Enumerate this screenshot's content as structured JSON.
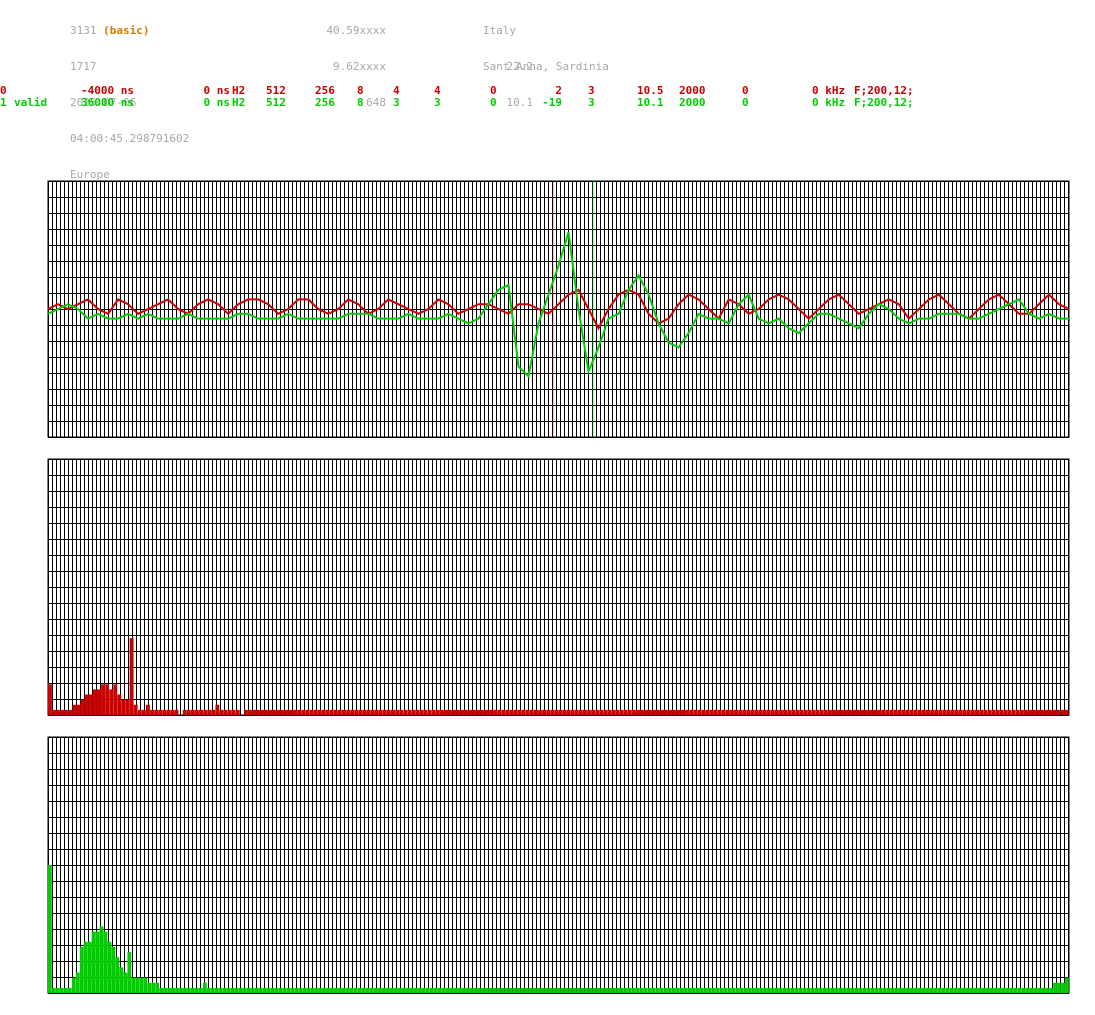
{
  "header": {
    "col1": [
      "3131",
      "1717",
      "2025-07-06",
      "04:00:45.298791602",
      "Europe"
    ],
    "basic_tag": "(basic)",
    "col2": [
      "40.59xxxx",
      "9.62xxxx",
      "648"
    ],
    "col3": [
      "Italy",
      "Sant Anna, Sardinia"
    ],
    "col4": [
      "22.2",
      "10.1"
    ]
  },
  "colors": {
    "red": "#cc0000",
    "green": "#00cc00",
    "grid": "#000000",
    "header_gray": "#a8a8a8",
    "basic_orange": "#d67a00"
  },
  "channels": [
    {
      "id": "0",
      "status": "",
      "offset": "-4000 ns",
      "delay": "0 ns",
      "type": "H2",
      "n1": "512",
      "n2": "256",
      "n3": "8",
      "n4": "4",
      "n5": "4",
      "n6": "0",
      "n7": "2",
      "n8": "3",
      "n9": "10.5",
      "n10": "2000",
      "n11": "0",
      "freq": "0 kHz",
      "filter": "F;200,12;"
    },
    {
      "id": "1",
      "status": "valid",
      "offset": "36000 ns",
      "delay": "0 ns",
      "type": "H2",
      "n1": "512",
      "n2": "256",
      "n3": "8",
      "n4": "3",
      "n5": "3",
      "n6": "0",
      "n7": "-19",
      "n8": "3",
      "n9": "10.1",
      "n10": "2000",
      "n11": "0",
      "freq": "0 kHz",
      "filter": "F;200,12;"
    }
  ],
  "chart_data": [
    {
      "type": "line",
      "title": "",
      "x": [
        0,
        10,
        20,
        30,
        40,
        50,
        60,
        70,
        80,
        90,
        100,
        110,
        120,
        130,
        140,
        150,
        160,
        170,
        180,
        190,
        200,
        210,
        220,
        230,
        240,
        250,
        260,
        270,
        280,
        290,
        300,
        310,
        320,
        330,
        340,
        350,
        360,
        370,
        380,
        390,
        400,
        410,
        420,
        430,
        440,
        450,
        460,
        470,
        480,
        490,
        500,
        510,
        520,
        530,
        540,
        550,
        560,
        570,
        580,
        590,
        600,
        610,
        620,
        630,
        640,
        650,
        660,
        670,
        680,
        690,
        700,
        710,
        720,
        730,
        740,
        750,
        760,
        770,
        780,
        790,
        800,
        810,
        820,
        830,
        840,
        850,
        860,
        870,
        880,
        890,
        900,
        910,
        920,
        930,
        940,
        950,
        960,
        970,
        980,
        990,
        1000,
        1010,
        1020
      ],
      "series": [
        {
          "color": "#cc0000",
          "values": [
            0.0,
            0.1,
            0.0,
            0.1,
            0.2,
            0.0,
            -0.1,
            0.2,
            0.1,
            -0.1,
            0.0,
            0.1,
            0.2,
            0.0,
            -0.1,
            0.1,
            0.2,
            0.1,
            -0.1,
            0.1,
            0.2,
            0.2,
            0.1,
            -0.1,
            0.0,
            0.2,
            0.2,
            0.0,
            -0.1,
            0.0,
            0.2,
            0.1,
            -0.1,
            0.0,
            0.2,
            0.1,
            0.0,
            -0.1,
            0.0,
            0.2,
            0.1,
            -0.1,
            0.0,
            0.1,
            0.1,
            0.0,
            -0.1,
            0.1,
            0.1,
            0.0,
            -0.1,
            0.1,
            0.3,
            0.4,
            0.0,
            -0.4,
            0.0,
            0.3,
            0.4,
            0.3,
            -0.1,
            -0.3,
            -0.2,
            0.1,
            0.3,
            0.2,
            0.0,
            -0.2,
            0.2,
            0.1,
            -0.1,
            0.0,
            0.2,
            0.3,
            0.2,
            0.0,
            -0.2,
            0.0,
            0.2,
            0.3,
            0.1,
            -0.1,
            0.0,
            0.1,
            0.2,
            0.1,
            -0.2,
            0.0,
            0.2,
            0.3,
            0.1,
            -0.1,
            -0.2,
            0.0,
            0.2,
            0.3,
            0.1,
            -0.1,
            -0.1,
            0.1,
            0.3,
            0.1,
            0.0
          ]
        },
        {
          "color": "#00cc00",
          "values": [
            -0.1,
            0.0,
            0.1,
            0.0,
            -0.2,
            -0.1,
            -0.2,
            -0.2,
            -0.1,
            -0.2,
            -0.1,
            -0.2,
            -0.2,
            -0.2,
            -0.1,
            -0.2,
            -0.2,
            -0.2,
            -0.2,
            -0.1,
            -0.1,
            -0.2,
            -0.2,
            -0.2,
            -0.1,
            -0.2,
            -0.2,
            -0.2,
            -0.2,
            -0.2,
            -0.1,
            -0.1,
            -0.1,
            -0.2,
            -0.2,
            -0.2,
            -0.1,
            -0.2,
            -0.2,
            -0.2,
            -0.1,
            -0.2,
            -0.3,
            -0.2,
            0.1,
            0.4,
            0.5,
            -1.2,
            -1.4,
            -0.3,
            0.3,
            0.9,
            1.6,
            0.0,
            -1.3,
            -0.8,
            -0.2,
            -0.1,
            0.4,
            0.7,
            0.3,
            -0.3,
            -0.7,
            -0.8,
            -0.5,
            -0.1,
            -0.2,
            -0.2,
            -0.3,
            0.1,
            0.3,
            -0.2,
            -0.3,
            -0.2,
            -0.4,
            -0.5,
            -0.3,
            -0.1,
            -0.1,
            -0.2,
            -0.3,
            -0.4,
            -0.1,
            0.1,
            0.0,
            -0.2,
            -0.3,
            -0.2,
            -0.2,
            -0.1,
            -0.1,
            -0.1,
            -0.2,
            -0.2,
            -0.1,
            0.0,
            0.1,
            0.2,
            -0.1,
            -0.2,
            -0.1,
            -0.2,
            -0.2
          ]
        }
      ],
      "xlim": [
        0,
        1020
      ],
      "ylim": [
        -2,
        2
      ],
      "grid": true
    },
    {
      "type": "bar",
      "title": "",
      "values": [
        6,
        1,
        1,
        1,
        1,
        1,
        2,
        2,
        3,
        4,
        4,
        5,
        5,
        6,
        6,
        5,
        6,
        4,
        3,
        3,
        15,
        2,
        1,
        1,
        2,
        1,
        1,
        1,
        1,
        1,
        1,
        1,
        0,
        1,
        1,
        1,
        1,
        1,
        1,
        1,
        1,
        2,
        1,
        1,
        1,
        1,
        1,
        0,
        1,
        1,
        1,
        1,
        1,
        1,
        1,
        1,
        1,
        1,
        1,
        1,
        1,
        1,
        1,
        1,
        1,
        1,
        1,
        1,
        1,
        1,
        1,
        1,
        1,
        1,
        1,
        1,
        1,
        1,
        1,
        1,
        1,
        1,
        1,
        1,
        1,
        1,
        1,
        1,
        1,
        1,
        1,
        1,
        1,
        1,
        1,
        1,
        1,
        1,
        1,
        1,
        1,
        1,
        1,
        1,
        1,
        1,
        1,
        1,
        1,
        1,
        1,
        1,
        1,
        1,
        1,
        1,
        1,
        1,
        1,
        1,
        1,
        1,
        1,
        1,
        1,
        1,
        1,
        1,
        1,
        1,
        1,
        1,
        1,
        1,
        1,
        1,
        1,
        1,
        1,
        1,
        1,
        1,
        1,
        1,
        1,
        1,
        1,
        1,
        1,
        1,
        1,
        1,
        1,
        1,
        1,
        1,
        1,
        1,
        1,
        1,
        1,
        1,
        1,
        1,
        1,
        1,
        1,
        1,
        1,
        1,
        1,
        1,
        1,
        1,
        1,
        1,
        1,
        1,
        1,
        1,
        1,
        1,
        1,
        1,
        1,
        1,
        1,
        1,
        1,
        1,
        1,
        1,
        1,
        1,
        1,
        1,
        1,
        1,
        1,
        1,
        1,
        1,
        1,
        1,
        1,
        1,
        1,
        1,
        1,
        1,
        1,
        1,
        1,
        1,
        1,
        1,
        1,
        1,
        1,
        1,
        1,
        1,
        1,
        1,
        1,
        1,
        1,
        1,
        1,
        1,
        1,
        1,
        1,
        1,
        1,
        1,
        1,
        1,
        1,
        1,
        1,
        1,
        1,
        1,
        1,
        1,
        1,
        1,
        1,
        1
      ],
      "color": "#cc0000",
      "ylim": [
        0,
        50
      ],
      "grid": true
    },
    {
      "type": "bar",
      "title": "",
      "values": [
        25,
        1,
        1,
        1,
        1,
        1,
        3,
        4,
        9,
        10,
        10,
        12,
        12,
        13,
        12,
        10,
        9,
        7,
        5,
        4,
        8,
        3,
        3,
        3,
        3,
        2,
        2,
        2,
        1,
        1,
        1,
        1,
        1,
        1,
        1,
        1,
        1,
        1,
        1,
        2,
        1,
        1,
        1,
        1,
        1,
        1,
        1,
        1,
        1,
        1,
        1,
        1,
        1,
        1,
        1,
        1,
        1,
        1,
        1,
        1,
        1,
        1,
        1,
        1,
        1,
        1,
        1,
        1,
        1,
        1,
        1,
        1,
        1,
        1,
        1,
        1,
        1,
        1,
        1,
        1,
        1,
        1,
        1,
        1,
        1,
        1,
        1,
        1,
        1,
        1,
        1,
        1,
        1,
        1,
        1,
        1,
        1,
        1,
        1,
        1,
        1,
        1,
        1,
        1,
        1,
        1,
        1,
        1,
        1,
        1,
        1,
        1,
        1,
        1,
        1,
        1,
        1,
        1,
        1,
        1,
        1,
        1,
        1,
        1,
        1,
        1,
        1,
        1,
        1,
        1,
        1,
        1,
        1,
        1,
        1,
        1,
        1,
        1,
        1,
        1,
        1,
        1,
        1,
        1,
        1,
        1,
        1,
        1,
        1,
        1,
        1,
        1,
        1,
        1,
        1,
        1,
        1,
        1,
        1,
        1,
        1,
        1,
        1,
        1,
        1,
        1,
        1,
        1,
        1,
        1,
        1,
        1,
        1,
        1,
        1,
        1,
        1,
        1,
        1,
        1,
        1,
        1,
        1,
        1,
        1,
        1,
        1,
        1,
        1,
        1,
        1,
        1,
        1,
        1,
        1,
        1,
        1,
        1,
        1,
        1,
        1,
        1,
        1,
        1,
        1,
        1,
        1,
        1,
        1,
        1,
        1,
        1,
        1,
        1,
        1,
        1,
        1,
        1,
        1,
        1,
        1,
        1,
        1,
        1,
        1,
        1,
        1,
        1,
        1,
        1,
        1,
        1,
        1,
        1,
        1,
        1,
        1,
        1,
        1,
        1,
        1,
        1,
        1,
        1,
        1,
        1,
        1,
        1,
        1,
        1,
        1,
        1,
        1,
        2,
        2,
        2,
        3
      ],
      "color": "#00cc00",
      "ylim": [
        0,
        50
      ],
      "grid": true
    }
  ]
}
